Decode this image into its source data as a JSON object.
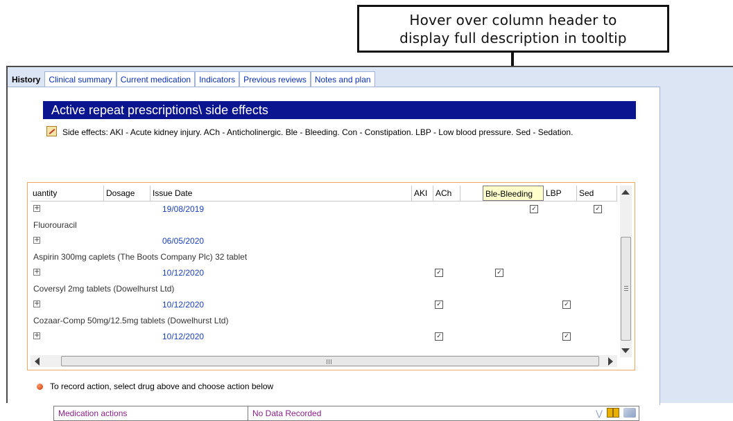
{
  "callout": {
    "line1": "Hover over column header to",
    "line2": "display full description in tooltip"
  },
  "tabs": [
    {
      "label": "History",
      "active": true
    },
    {
      "label": "Clinical summary",
      "active": false
    },
    {
      "label": "Current medication",
      "active": false
    },
    {
      "label": "Indicators",
      "active": false
    },
    {
      "label": "Previous reviews",
      "active": false
    },
    {
      "label": "Notes and plan",
      "active": false
    }
  ],
  "section_title": "Active repeat prescriptions\\ side effects",
  "side_effects": "Side effects: AKI - Acute kidney injury. ACh - Anticholinergic. Ble - Bleeding. Con - Constipation. LBP - Low blood pressure. Sed - Sedation.",
  "grid": {
    "columns": {
      "quantity": "uantity",
      "dosage": "Dosage",
      "issue_date": "Issue Date",
      "aki": "AKI",
      "ach": "ACh",
      "ble": "Ble-Bleeding",
      "lbp": "LBP",
      "sed": "Sed"
    },
    "rows": [
      {
        "type": "issue",
        "date": "19/08/2019",
        "checks": [
          "ble",
          "sed"
        ]
      },
      {
        "type": "drug",
        "name": "Fluorouracil"
      },
      {
        "type": "issue",
        "date": "06/05/2020",
        "checks": []
      },
      {
        "type": "drug",
        "name": "Aspirin 300mg caplets (The Boots Company Plc) 32 tablet"
      },
      {
        "type": "issue",
        "date": "10/12/2020",
        "checks": [
          "aki",
          "ach"
        ]
      },
      {
        "type": "drug",
        "name": "Coversyl 2mg tablets (Dowelhurst Ltd)"
      },
      {
        "type": "issue",
        "date": "10/12/2020",
        "checks": [
          "aki",
          "lbp"
        ]
      },
      {
        "type": "drug",
        "name": "Cozaar-Comp 50mg/12.5mg tablets (Dowelhurst Ltd)"
      },
      {
        "type": "issue",
        "date": "10/12/2020",
        "checks": [
          "aki",
          "lbp"
        ]
      }
    ]
  },
  "instruction": "To record action, select drug above and choose action below",
  "medication_actions": {
    "label": "Medication actions",
    "value": "No Data Recorded"
  },
  "colors": {
    "title_bar": "#0b1590",
    "tab_link": "#0a2fb8",
    "issue_date": "#1a3fbf",
    "tooltip_bg": "#ffffcc",
    "grid_border": "#f0a860"
  }
}
